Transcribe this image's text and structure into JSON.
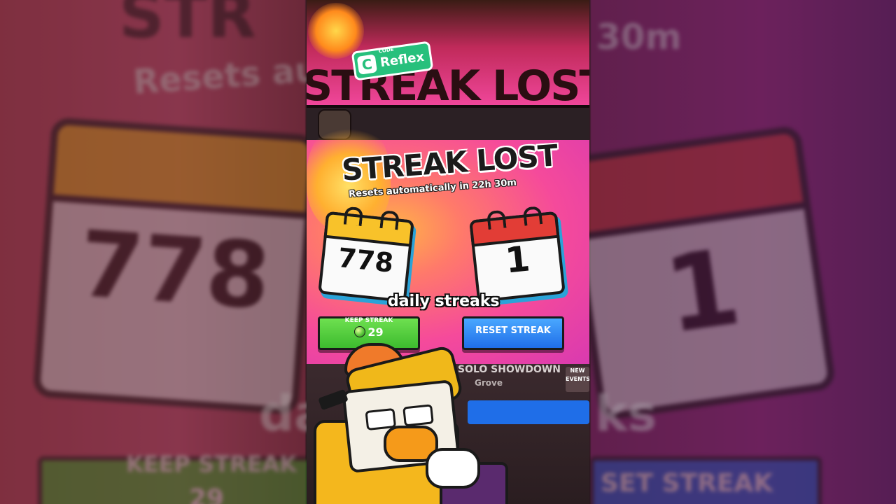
{
  "logo": {
    "small": "CODE",
    "name": "Reflex",
    "mark": "C"
  },
  "bg": {
    "left_subtitle": "Resets aut",
    "left_number": "778",
    "left_caption": "da",
    "left_button": "KEEP STREAK",
    "left_cost": "29",
    "right_timer": "30m",
    "right_number": "1",
    "right_caption": "ks",
    "right_button": "SET STREAK",
    "top_left_title": "STR"
  },
  "ghost_title": "STREAK LOST",
  "title": "STREAK LOST",
  "subtitle": "Resets automatically in 22h 30m",
  "calendars": {
    "old": "778",
    "new": "1"
  },
  "caption": "daily streaks",
  "keep": {
    "label": "KEEP STREAK",
    "cost": "29"
  },
  "reset": {
    "label": "RESET STREAK"
  },
  "event": {
    "mode": "SOLO SHOWDOWN",
    "map": "Grove",
    "badge": "NEW EVENTS"
  },
  "colors": {
    "pink": "#f54a9b",
    "green": "#3dbb2e",
    "blue": "#1f6ee8",
    "accent": "#27c07c"
  }
}
